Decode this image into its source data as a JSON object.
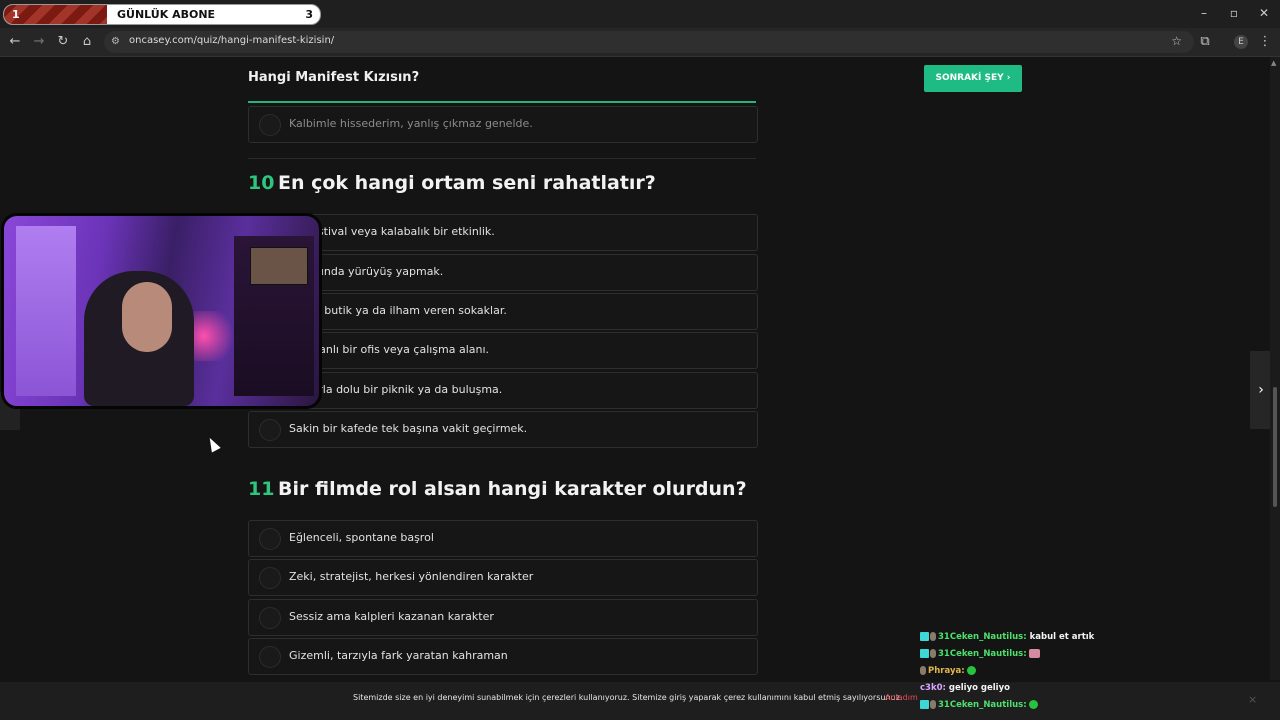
{
  "browser": {
    "url": "oncasey.com/quiz/hangi-manifest-kizisin/",
    "profile_initial": "E"
  },
  "sub_banner": {
    "left_number": "1",
    "title": "GÜNLÜK ABONE",
    "right_number": "3",
    "progress_fraction": 0.33
  },
  "quiz": {
    "sticky_title": "Hangi Manifest Kızısın?",
    "next_button": "SONRAKİ ŞEY",
    "prev_option": "Kalbimle hissederim, yanlış çıkmaz genelde.",
    "q10": {
      "number": "10",
      "text": "En çok hangi ortam seni rahatlatır?",
      "options": [
        "er, festival veya kalabalık bir etkinlik.",
        "batımında yürüyüş yapmak.",
        "ge bir butik ya da ilham veren sokaklar.",
        "nli, planlı bir ofis veya çalışma alanı.",
        "daşlarla dolu bir piknik ya da buluşma.",
        "Sakin bir kafede tek başına vakit geçirmek."
      ]
    },
    "q11": {
      "number": "11",
      "text": "Bir filmde rol alsan hangi karakter olurdun?",
      "options": [
        "Eğlenceli, spontane başrol",
        "Zeki, stratejist, herkesi yönlendiren karakter",
        "Sessiz ama kalpleri kazanan karakter",
        "Gizemli, tarzıyla fark yaratan kahraman"
      ]
    }
  },
  "cookie": {
    "text": "Sitemizde size en iyi deneyimi sunabilmek için çerezleri kullanıyoruz. Sitemize giriş yaparak çerez kullanımını kabul etmiş sayılıyorsunuz.",
    "accept": "Anladım",
    "close": "×"
  },
  "chat": [
    {
      "user": "31Ceken_Nautilus:",
      "message": "kabul et artık"
    },
    {
      "user": "31Ceken_Nautilus:",
      "message": ""
    },
    {
      "user": "Phraya:",
      "message": ""
    },
    {
      "user": "c3k0:",
      "message": "geliyo geliyo"
    },
    {
      "user": "31Ceken_Nautilus:",
      "message": ""
    }
  ],
  "colors": {
    "accent_green": "#1fbb85",
    "question_number": "#2fc57f",
    "cookie_accept": "#e44b55"
  }
}
